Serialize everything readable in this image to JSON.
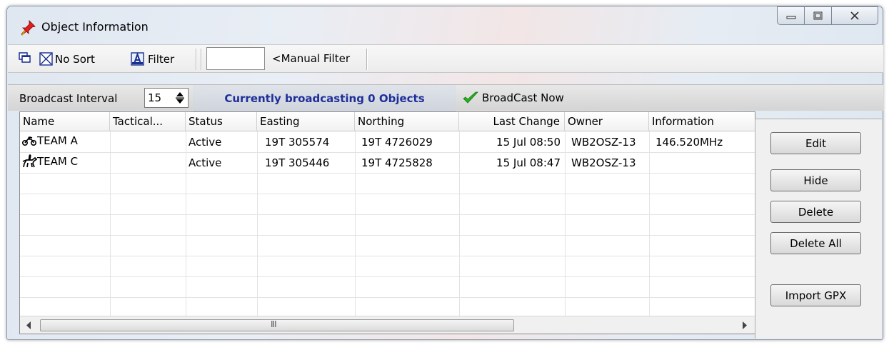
{
  "window": {
    "title": "Object Information",
    "title_icon": "pushpin-icon"
  },
  "toolbar": {
    "no_sort_label": "No Sort",
    "filter_label": "Filter",
    "manual_filter_value": "",
    "manual_filter_label": "<Manual Filter"
  },
  "broadcast": {
    "interval_label": "Broadcast Interval",
    "interval_value": "15",
    "status_text": "Currently broadcasting 0 Objects",
    "broadcast_now_label": "BroadCast Now",
    "status_color": "#1f2f9a"
  },
  "table": {
    "columns": [
      "Name",
      "Tactical...",
      "Status",
      "Easting",
      "Northing",
      "Last Change",
      "Owner",
      "Information"
    ],
    "rows": [
      {
        "icon": "motorcycle-icon",
        "name": "TEAM A",
        "tactical": "",
        "status": "Active",
        "easting": "19T 305574",
        "northing": "19T 4726029",
        "last_change": "15 Jul 08:50",
        "owner": "WB2OSZ-13",
        "information": "146.520MHz"
      },
      {
        "icon": "horse-rider-icon",
        "name": "TEAM C",
        "tactical": "",
        "status": "Active",
        "easting": "19T 305446",
        "northing": "19T 4725828",
        "last_change": "15 Jul 08:47",
        "owner": "WB2OSZ-13",
        "information": ""
      }
    ],
    "scroll_thumb_grip": "III"
  },
  "buttons": {
    "edit": "Edit",
    "hide": "Hide",
    "delete": "Delete",
    "delete_all": "Delete All",
    "import_gpx": "Import GPX"
  }
}
